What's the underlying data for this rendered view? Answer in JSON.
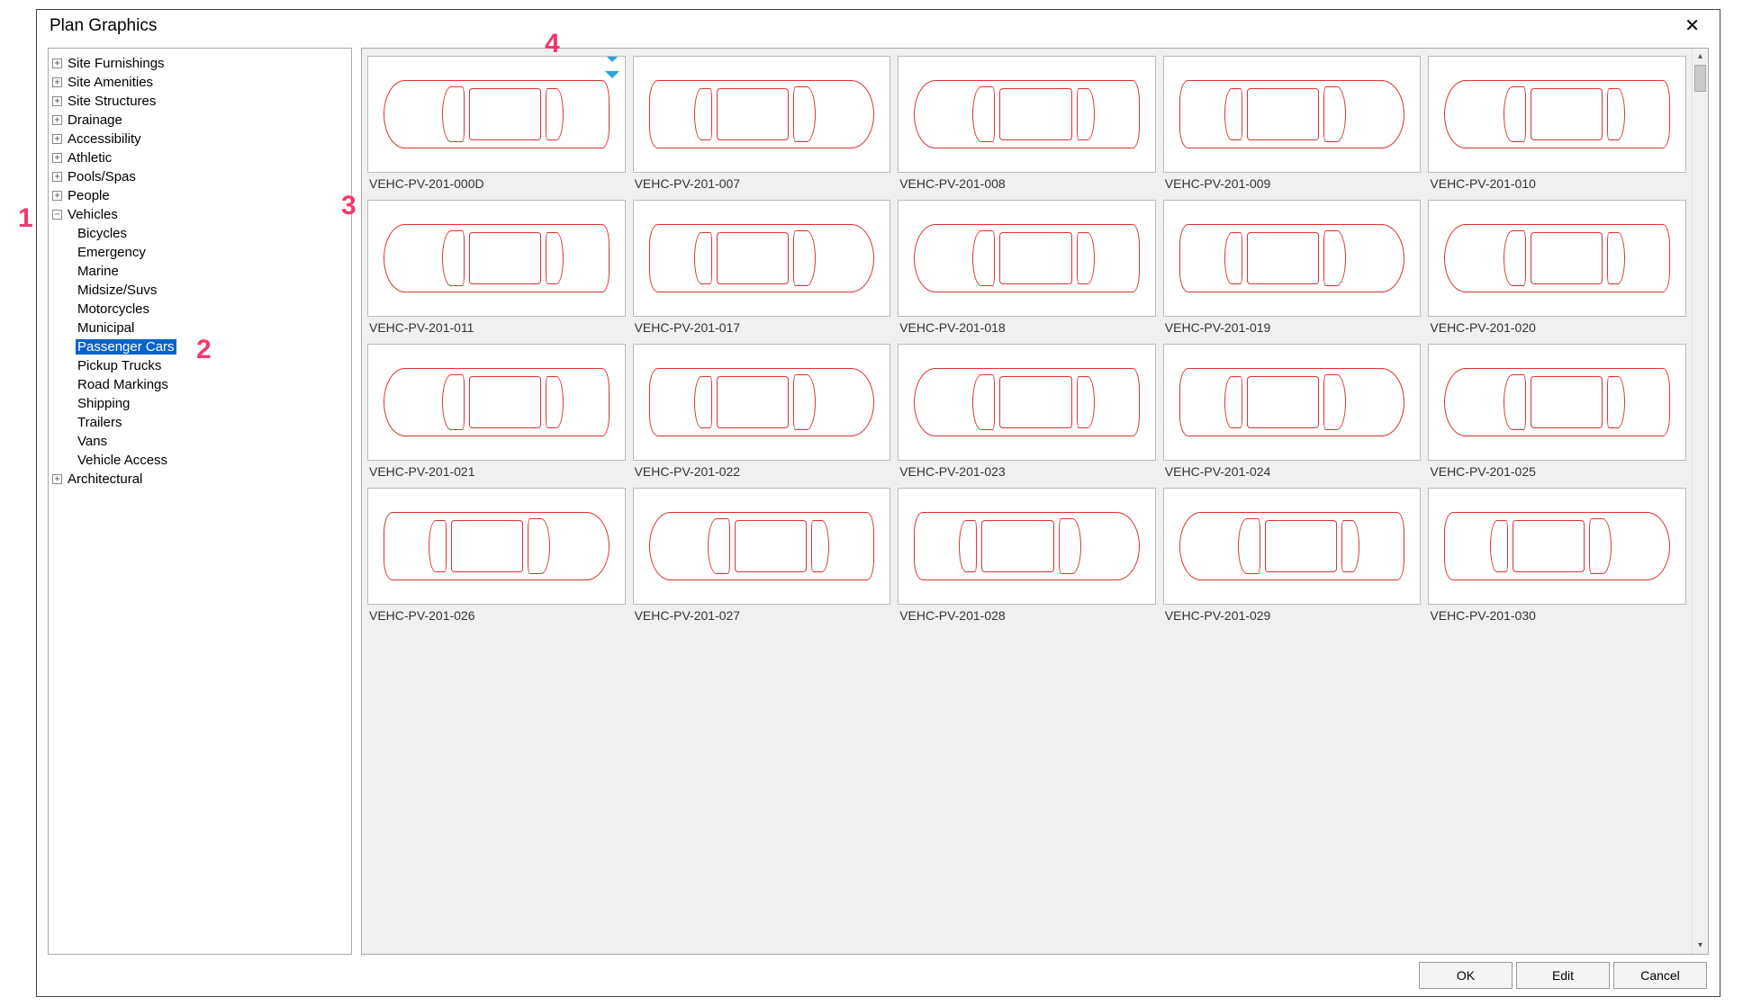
{
  "dialog": {
    "title": "Plan Graphics",
    "close_glyph": "✕"
  },
  "tree": {
    "items": [
      {
        "label": "Site Furnishings",
        "expanded": false,
        "children": []
      },
      {
        "label": "Site Amenities",
        "expanded": false,
        "children": []
      },
      {
        "label": "Site Structures",
        "expanded": false,
        "children": []
      },
      {
        "label": "Drainage",
        "expanded": false,
        "children": []
      },
      {
        "label": "Accessibility",
        "expanded": false,
        "children": []
      },
      {
        "label": "Athletic",
        "expanded": false,
        "children": []
      },
      {
        "label": "Pools/Spas",
        "expanded": false,
        "children": []
      },
      {
        "label": "People",
        "expanded": false,
        "children": []
      },
      {
        "label": "Vehicles",
        "expanded": true,
        "children": [
          {
            "label": "Bicycles",
            "selected": false
          },
          {
            "label": "Emergency",
            "selected": false
          },
          {
            "label": "Marine",
            "selected": false
          },
          {
            "label": "Midsize/Suvs",
            "selected": false
          },
          {
            "label": "Motorcycles",
            "selected": false
          },
          {
            "label": "Municipal",
            "selected": false
          },
          {
            "label": "Passenger Cars",
            "selected": true
          },
          {
            "label": "Pickup Trucks",
            "selected": false
          },
          {
            "label": "Road Markings",
            "selected": false
          },
          {
            "label": "Shipping",
            "selected": false
          },
          {
            "label": "Trailers",
            "selected": false
          },
          {
            "label": "Vans",
            "selected": false
          },
          {
            "label": "Vehicle Access",
            "selected": false
          }
        ]
      },
      {
        "label": "Architectural",
        "expanded": false,
        "children": []
      }
    ]
  },
  "thumbnails": [
    {
      "label": "VEHC-PV-201-000D",
      "has_marker": true,
      "variant": 0
    },
    {
      "label": "VEHC-PV-201-007",
      "has_marker": false,
      "variant": 1
    },
    {
      "label": "VEHC-PV-201-008",
      "has_marker": false,
      "variant": 0
    },
    {
      "label": "VEHC-PV-201-009",
      "has_marker": false,
      "variant": 1
    },
    {
      "label": "VEHC-PV-201-010",
      "has_marker": false,
      "variant": 0
    },
    {
      "label": "VEHC-PV-201-011",
      "has_marker": false,
      "variant": 0
    },
    {
      "label": "VEHC-PV-201-017",
      "has_marker": false,
      "variant": 1
    },
    {
      "label": "VEHC-PV-201-018",
      "has_marker": false,
      "variant": 0
    },
    {
      "label": "VEHC-PV-201-019",
      "has_marker": false,
      "variant": 1
    },
    {
      "label": "VEHC-PV-201-020",
      "has_marker": false,
      "variant": 0
    },
    {
      "label": "VEHC-PV-201-021",
      "has_marker": false,
      "variant": 0
    },
    {
      "label": "VEHC-PV-201-022",
      "has_marker": false,
      "variant": 1
    },
    {
      "label": "VEHC-PV-201-023",
      "has_marker": false,
      "variant": 0
    },
    {
      "label": "VEHC-PV-201-024",
      "has_marker": false,
      "variant": 1
    },
    {
      "label": "VEHC-PV-201-025",
      "has_marker": false,
      "variant": 0
    },
    {
      "label": "VEHC-PV-201-026",
      "has_marker": false,
      "variant": 1
    },
    {
      "label": "VEHC-PV-201-027",
      "has_marker": false,
      "variant": 0
    },
    {
      "label": "VEHC-PV-201-028",
      "has_marker": false,
      "variant": 1
    },
    {
      "label": "VEHC-PV-201-029",
      "has_marker": false,
      "variant": 0
    },
    {
      "label": "VEHC-PV-201-030",
      "has_marker": false,
      "variant": 1
    }
  ],
  "footer": {
    "ok": "OK",
    "edit": "Edit",
    "cancel": "Cancel"
  },
  "callouts": {
    "c1": "1",
    "c2": "2",
    "c3": "3",
    "c4": "4"
  },
  "glyphs": {
    "plus": "+",
    "minus": "−",
    "up": "▴",
    "down": "▾"
  }
}
